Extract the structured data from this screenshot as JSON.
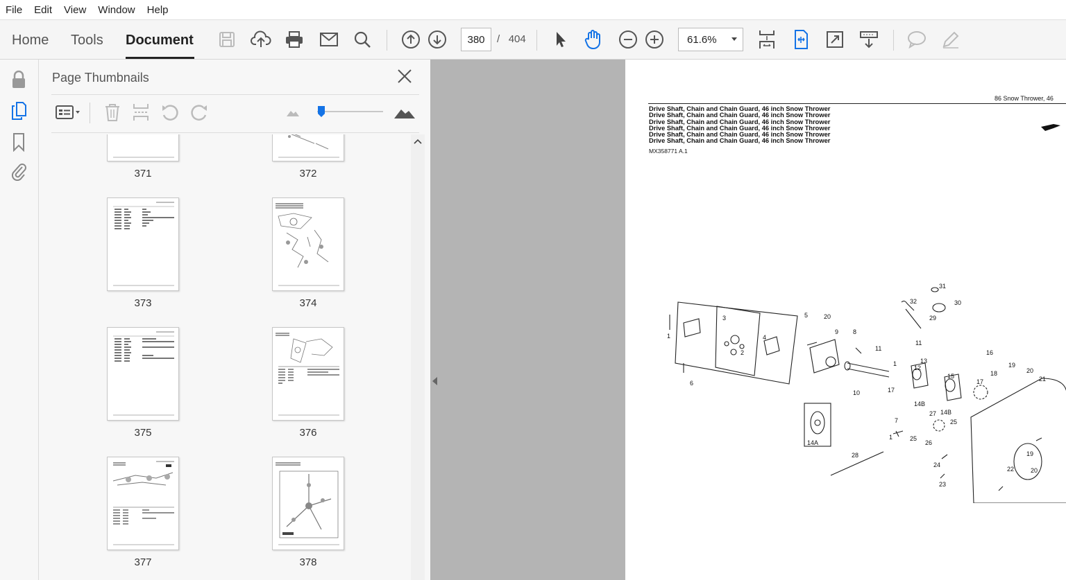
{
  "menu": [
    "File",
    "Edit",
    "View",
    "Window",
    "Help"
  ],
  "nav_tabs": {
    "home": "Home",
    "tools": "Tools",
    "document": "Document"
  },
  "page_nav": {
    "current": "380",
    "separator": "/",
    "total": "404"
  },
  "zoom": {
    "value": "61.6%"
  },
  "panel": {
    "title": "Page Thumbnails",
    "thumbnails": [
      {
        "label": "371"
      },
      {
        "label": "372"
      },
      {
        "label": "373"
      },
      {
        "label": "374"
      },
      {
        "label": "375"
      },
      {
        "label": "376"
      },
      {
        "label": "377"
      },
      {
        "label": "378"
      }
    ]
  },
  "document": {
    "header": "86 Snow Thrower, 46",
    "title_lines": [
      "Drive Shaft, Chain and Chain Guard, 46 inch Snow Thrower",
      "Drive Shaft, Chain and Chain Guard, 46 inch Snow Thrower",
      "Drive Shaft, Chain and Chain Guard, 46 inch Snow Thrower",
      "Drive Shaft, Chain and Chain Guard, 46 inch Snow Thrower",
      "Drive Shaft, Chain and Chain Guard, 46 inch Snow Thrower",
      "Drive Shaft, Chain and Chain Guard, 46 inch Snow Thrower"
    ],
    "ref": "MX358771 A.1",
    "callouts": [
      "1",
      "2",
      "3",
      "4",
      "5",
      "6",
      "20",
      "9",
      "8",
      "11",
      "11",
      "12",
      "13",
      "10",
      "17",
      "14B",
      "14B",
      "15",
      "16",
      "17",
      "18",
      "19",
      "20",
      "21",
      "31",
      "32",
      "30",
      "29",
      "27",
      "25",
      "26",
      "25",
      "24",
      "23",
      "22",
      "19",
      "20",
      "28",
      "14A",
      "1",
      "7"
    ]
  },
  "colors": {
    "accent": "#1473e6",
    "toolbar_bg": "#f5f5f5",
    "gutter": "#b4b4b4"
  }
}
